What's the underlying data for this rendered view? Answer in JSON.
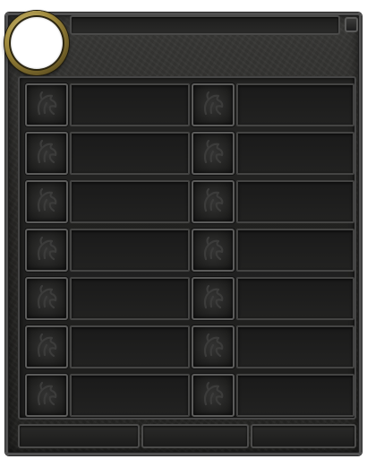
{
  "window": {
    "title": "",
    "accent_colors": {
      "frame": "#2b2a28",
      "border": "#505050",
      "portrait_ring": "#a08a3c",
      "slot_border": "#5b5b5a"
    }
  },
  "portrait": {
    "icon": "empty-portrait"
  },
  "slots": {
    "icon": "horse-emblem-icon",
    "left_column": [
      {
        "label": ""
      },
      {
        "label": ""
      },
      {
        "label": ""
      },
      {
        "label": ""
      },
      {
        "label": ""
      },
      {
        "label": ""
      },
      {
        "label": ""
      }
    ],
    "right_column": [
      {
        "label": ""
      },
      {
        "label": ""
      },
      {
        "label": ""
      },
      {
        "label": ""
      },
      {
        "label": ""
      },
      {
        "label": ""
      },
      {
        "label": ""
      }
    ]
  },
  "bottom_bar": {
    "segments": [
      {
        "label": ""
      },
      {
        "label": ""
      },
      {
        "label": ""
      }
    ]
  }
}
